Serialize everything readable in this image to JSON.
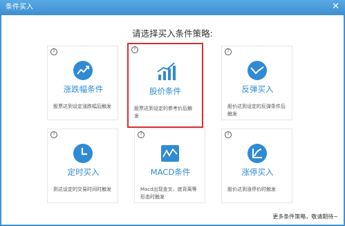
{
  "window": {
    "title": "条件买入",
    "close_glyph": "✕"
  },
  "heading": "请选择买入条件策略:",
  "help_glyph": "?",
  "accent_color": "#2f8bd4",
  "selected_border_color": "#d42e2e",
  "cards": [
    {
      "icon": "trend-up-icon",
      "name": "涨跌幅条件",
      "desc": "股票达到设定涨跌幅后触发"
    },
    {
      "icon": "bar-chart-icon",
      "name": "股价条件",
      "desc": "股票达到设定的参考价后触发",
      "selected": true
    },
    {
      "icon": "rebound-icon",
      "name": "反弹买入",
      "desc": "股价达到设定的反弹条件后触发"
    },
    {
      "icon": "clock-icon",
      "name": "定时买入",
      "desc": "到达设定的交易时间时触发"
    },
    {
      "icon": "macd-icon",
      "name": "MACD条件",
      "desc": "Macd出现金叉、底背离等形态时触发"
    },
    {
      "icon": "limit-up-icon",
      "name": "涨停买入",
      "desc": "股价达到涨停价时触发"
    }
  ],
  "footer": "更多条件策略，敬请期待~"
}
